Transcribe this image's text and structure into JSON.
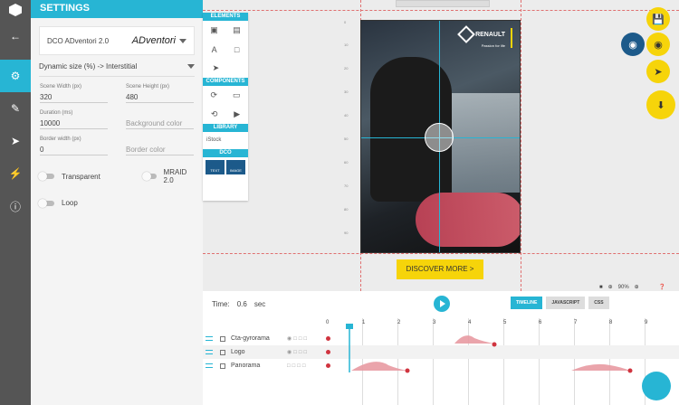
{
  "app": {
    "accent": "#27b5d4",
    "cta_color": "#f6d40a",
    "sidebar_color": "#555555"
  },
  "rail": [
    "logo-icon",
    "back-arrow-icon",
    "gear-icon",
    "pencil-icon",
    "share-icon",
    "bolt-icon",
    "info-icon"
  ],
  "settings": {
    "title": "SETTINGS",
    "dco_label": "DCO ADventori 2.0",
    "dco_brand": "ADventori",
    "size_mode": "Dynamic size (%) -> Interstitial",
    "scene_width_label": "Scene Width (px)",
    "scene_width": "320",
    "scene_height_label": "Scene Height (px)",
    "scene_height": "480",
    "duration_label": "Duration (ms)",
    "duration": "10000",
    "bg_color_placeholder": "Background color",
    "border_width_label": "Border width (px)",
    "border_width": "0",
    "border_color_placeholder": "Border color",
    "transparent_label": "Transparent",
    "mraid_label": "MRAID 2.0",
    "loop_label": "Loop"
  },
  "tools": {
    "elements": "ELEMENTS",
    "components": "COMPONENTS",
    "library": "LIBRARY",
    "library_item": "iStock",
    "dco": "DCO",
    "dco_text": "TEXT",
    "dco_image": "IMAGE"
  },
  "canvas": {
    "brand": "RENAULT",
    "tagline": "Passion for life",
    "cta": "DISCOVER MORE >",
    "zoom": "90%",
    "ruler": [
      "0",
      "10",
      "20",
      "30",
      "40",
      "50",
      "60",
      "70",
      "80",
      "90",
      "100"
    ]
  },
  "timeline": {
    "time_label": "Time:",
    "time_value": "0.6",
    "time_unit": "sec",
    "tabs": [
      "TIMELINE",
      "JAVASCRIPT",
      "CSS"
    ],
    "ticks": [
      "0",
      "1",
      "2",
      "3",
      "4",
      "5",
      "6",
      "7",
      "8",
      "9"
    ],
    "layers": [
      "Cta-gyrorama",
      "Logo",
      "Panorama"
    ],
    "playhead_sec": 0.6
  }
}
